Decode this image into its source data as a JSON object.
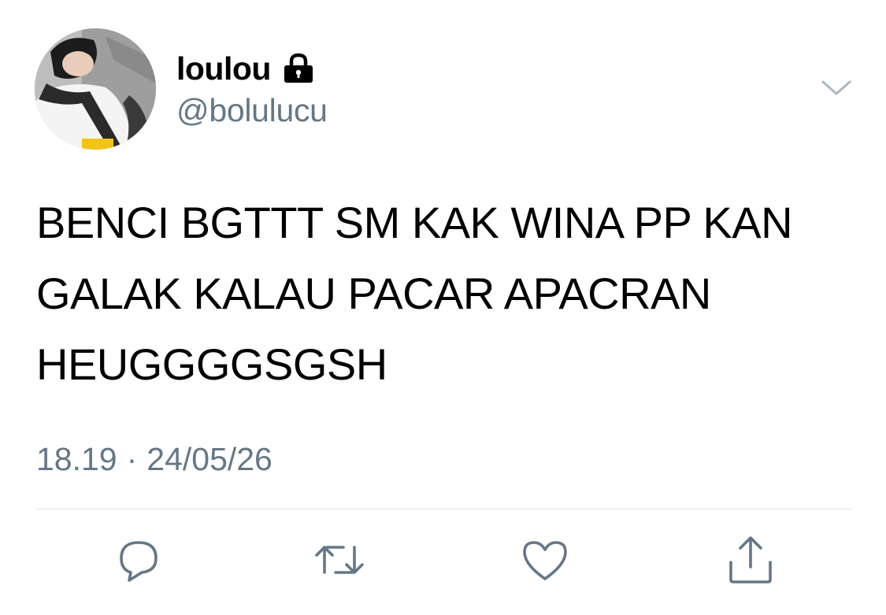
{
  "tweet": {
    "display_name": "loulou",
    "handle": "@bolulucu",
    "is_protected": true,
    "text": "BENCI BGTTT SM KAK WINA PP KAN\nGALAK KALAU PACAR APACRAN\nHEUGGGGSGSH",
    "time": "18.19",
    "separator": "·",
    "date": "24/05/26"
  },
  "icons": {
    "lock": "lock-icon",
    "more": "chevron-down-icon",
    "reply": "reply-icon",
    "retweet": "retweet-icon",
    "like": "heart-icon",
    "share": "share-icon"
  },
  "colors": {
    "text_primary": "#000000",
    "text_secondary": "#657786",
    "icon_gray": "#657786",
    "divider": "#dfe3e6",
    "background": "#ffffff"
  }
}
